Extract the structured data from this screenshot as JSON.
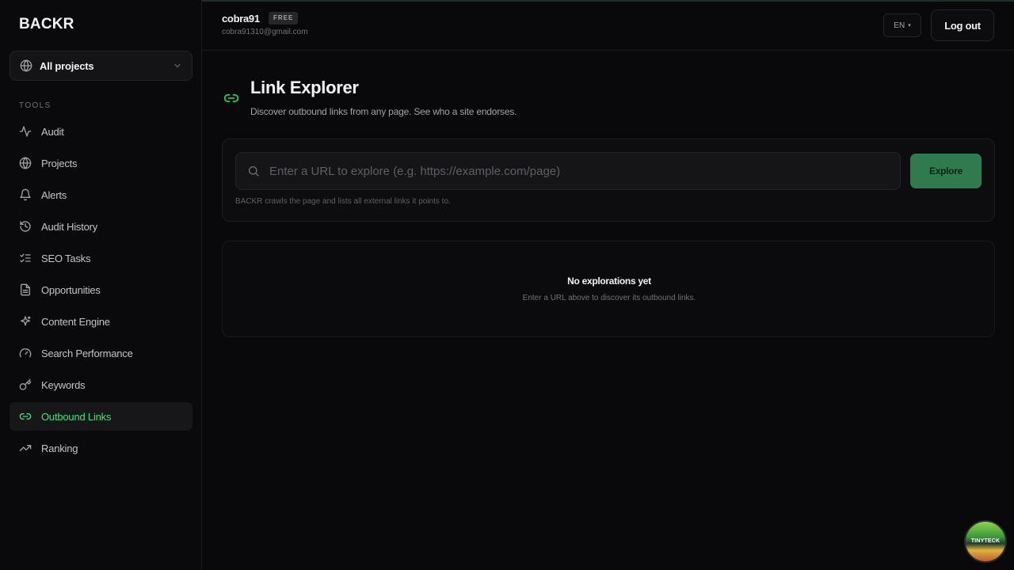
{
  "brand": "BACKR",
  "project_selector": {
    "label": "All projects"
  },
  "sidebar": {
    "section_label": "TOOLS",
    "items": [
      {
        "label": "Audit",
        "icon": "activity-icon"
      },
      {
        "label": "Projects",
        "icon": "globe-icon"
      },
      {
        "label": "Alerts",
        "icon": "bell-icon"
      },
      {
        "label": "Audit History",
        "icon": "history-icon"
      },
      {
        "label": "SEO Tasks",
        "icon": "list-checks-icon"
      },
      {
        "label": "Opportunities",
        "icon": "file-text-icon"
      },
      {
        "label": "Content Engine",
        "icon": "sparkles-icon"
      },
      {
        "label": "Search Performance",
        "icon": "gauge-icon"
      },
      {
        "label": "Keywords",
        "icon": "key-icon"
      },
      {
        "label": "Outbound Links",
        "icon": "link-icon",
        "active": true
      },
      {
        "label": "Ranking",
        "icon": "trending-up-icon"
      }
    ]
  },
  "header": {
    "user_name": "cobra91",
    "plan_badge": "FREE",
    "user_email": "cobra91310@gmail.com",
    "language": "EN",
    "logout_label": "Log out"
  },
  "main": {
    "title": "Link Explorer",
    "subtitle": "Discover outbound links from any page. See who a site endorses.",
    "search": {
      "value": "",
      "placeholder": "Enter a URL to explore (e.g. https://example.com/page)",
      "button_label": "Explore",
      "helper": "BACKR crawls the page and lists all external links it points to."
    },
    "empty_state": {
      "title": "No explorations yet",
      "description": "Enter a URL above to discover its outbound links."
    }
  },
  "floating_badge": {
    "text": "TINYTECK"
  },
  "colors": {
    "accent": "#22c55e",
    "accent_text": "#4ade80",
    "button_bg": "#2f7a4f",
    "background": "#09090b"
  }
}
